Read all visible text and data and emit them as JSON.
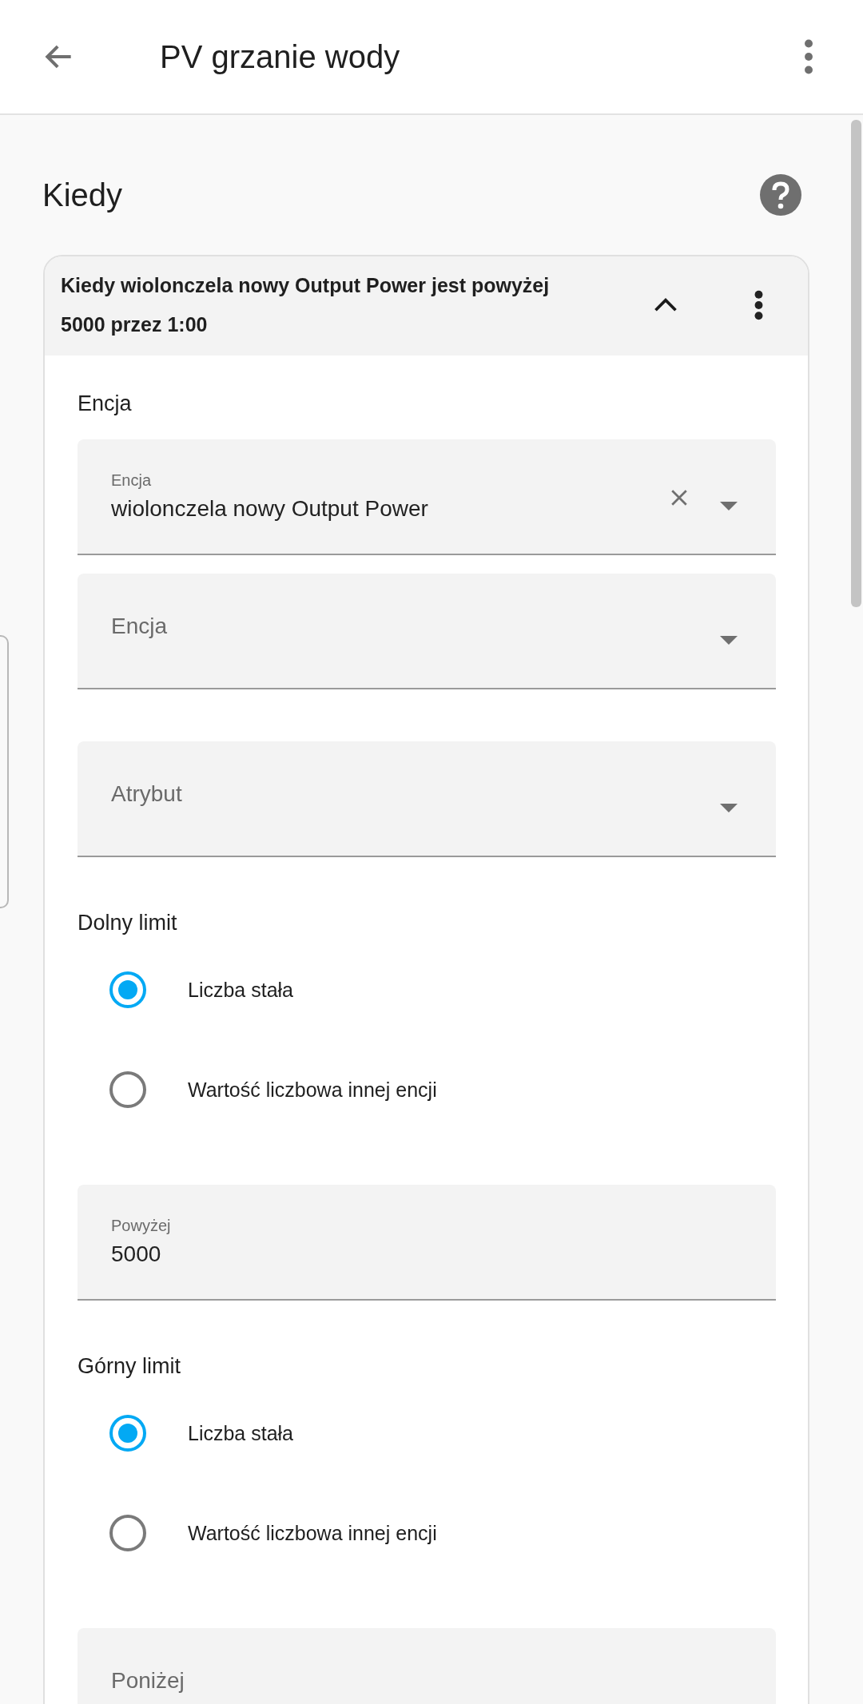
{
  "app_bar": {
    "title": "PV grzanie wody"
  },
  "section": {
    "title": "Kiedy"
  },
  "trigger": {
    "title": "Kiedy wiolonczela nowy Output Power jest powyżej 5000 przez 1:00",
    "expanded": true,
    "entity_heading": "Encja",
    "fields": [
      {
        "kind": "select",
        "label": "Encja",
        "value": "wiolonczela nowy Output Power",
        "clearable": true
      },
      {
        "kind": "select",
        "placeholder": "Encja",
        "clearable": false
      },
      {
        "kind": "select",
        "placeholder": "Atrybut",
        "clearable": false
      }
    ],
    "limits": [
      {
        "title": "Dolny limit",
        "options": [
          {
            "label": "Liczba stała",
            "selected": true
          },
          {
            "label": "Wartość liczbowa innej encji",
            "selected": false
          }
        ],
        "field": {
          "kind": "number",
          "label": "Powyżej",
          "value": "5000"
        }
      },
      {
        "title": "Górny limit",
        "options": [
          {
            "label": "Liczba stała",
            "selected": true
          },
          {
            "label": "Wartość liczbowa innej encji",
            "selected": false
          }
        ],
        "field": {
          "kind": "number",
          "placeholder": "Poniżej"
        }
      }
    ]
  }
}
